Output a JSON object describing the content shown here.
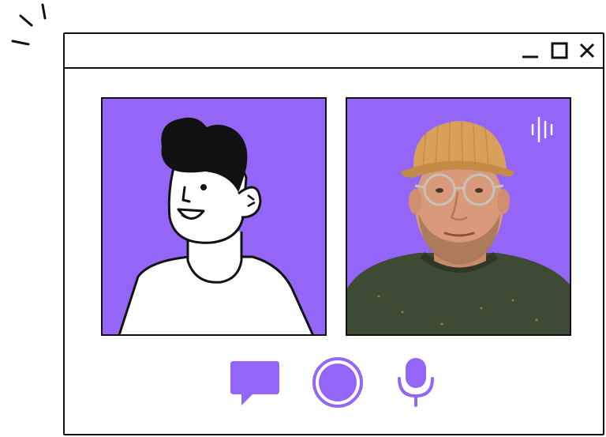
{
  "window": {
    "controls": [
      "minimize-icon",
      "maximize-icon",
      "close-icon"
    ]
  },
  "participants": [
    {
      "kind": "illustrated-avatar"
    },
    {
      "kind": "camera-video",
      "speaking_indicator": "sound-wave-icon"
    }
  ],
  "call_controls": [
    "chat-icon",
    "record-icon",
    "microphone-icon"
  ],
  "colors": {
    "accent": "#9466F7",
    "outline": "#111111",
    "background": "#FFFFFF"
  }
}
